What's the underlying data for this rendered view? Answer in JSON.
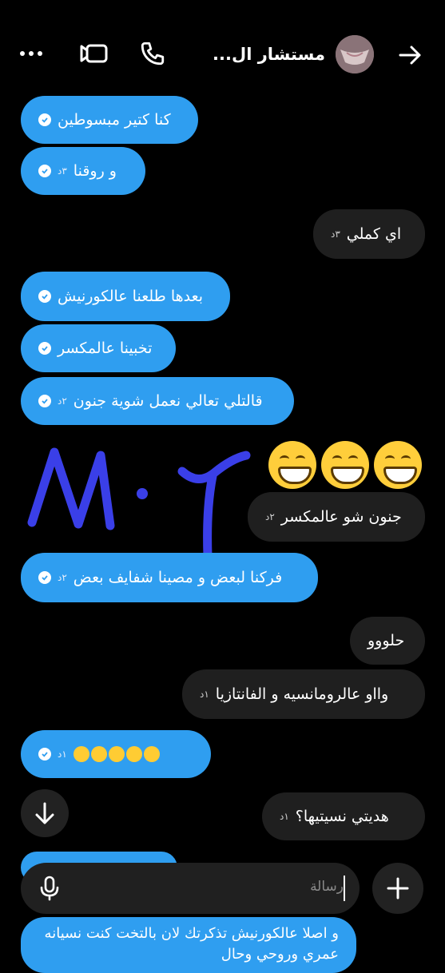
{
  "header": {
    "title": "مستشار ال...",
    "back_icon": "arrow-right-icon",
    "call_icon": "phone-icon",
    "video_icon": "video-icon",
    "more_icon": "more-icon"
  },
  "messages": [
    {
      "text": "كنا كتير مبسوطين",
      "time": "",
      "type": "sent"
    },
    {
      "text": "و روقنا",
      "time": "٣د",
      "type": "sent"
    },
    {
      "text": "اي كملي",
      "time": "٣د",
      "type": "recv"
    },
    {
      "text": "بعدها طلعنا عالكورنيش",
      "time": "",
      "type": "sent"
    },
    {
      "text": "تخبينا عالمكسر",
      "time": "",
      "type": "sent"
    },
    {
      "text": "قالتلي تعالي نعمل شوية جنون",
      "time": "٢د",
      "type": "sent"
    },
    {
      "text": "😁😁😁",
      "time": "",
      "type": "recv-emoji"
    },
    {
      "text": "جنون شو عالمكسر",
      "time": "٢د",
      "type": "recv"
    },
    {
      "text": "فركنا لبعض و مصينا شفايف بعض",
      "time": "٢د",
      "type": "sent"
    },
    {
      "text": "حلووو",
      "time": "",
      "type": "recv"
    },
    {
      "text": "وااو عالرومانسيه و الفانتازيا",
      "time": "١د",
      "type": "recv"
    },
    {
      "text": "🤭🤭🤣🤣",
      "time": "١د",
      "type": "sent"
    },
    {
      "text": "هديتي نسيتيها؟",
      "time": "١د",
      "type": "recv"
    }
  ],
  "partial_message": "و اصلا عالكورنيش تذكرتك لان بالتخت كنت نسيانه عمري وروحي وحال",
  "handwriting": "M·٢",
  "composer": {
    "placeholder": "رسالة",
    "mic_icon": "mic-icon",
    "plus_icon": "plus-icon",
    "scroll_down_icon": "arrow-down-icon"
  },
  "colors": {
    "sent_bubble": "#2f9ef0",
    "received_bubble": "#1f1f1f",
    "background": "#000000",
    "handwriting": "#3a3fe8"
  }
}
